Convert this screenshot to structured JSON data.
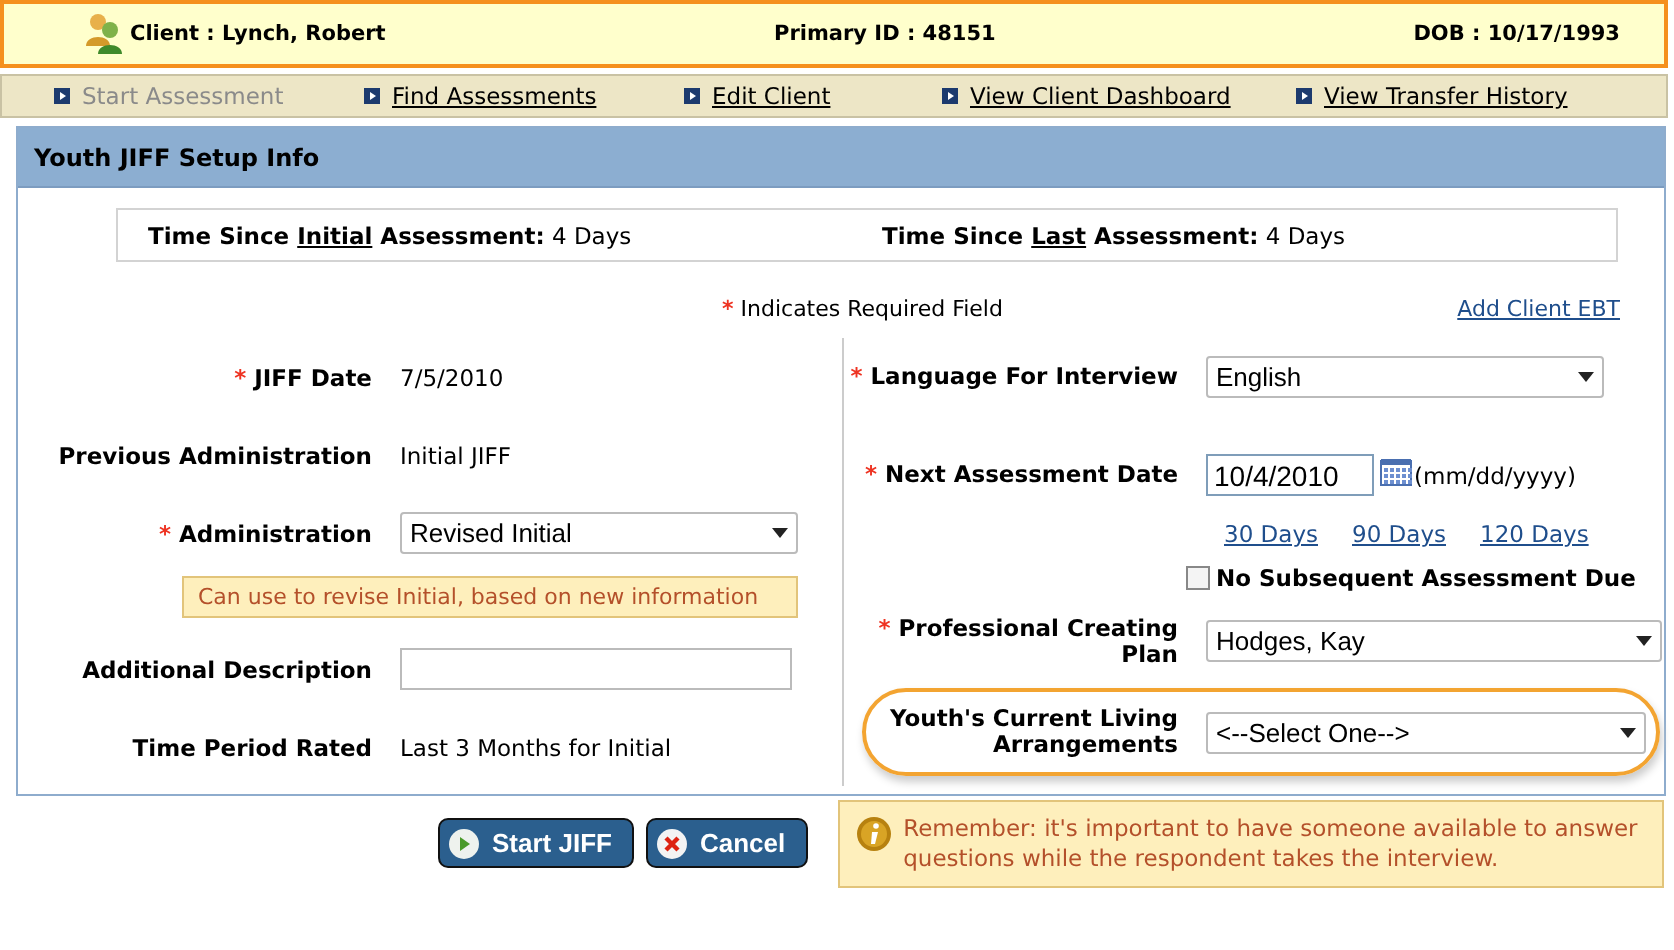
{
  "client_header": {
    "client": "Client : Lynch, Robert",
    "primary_id": "Primary ID : 48151",
    "dob": "DOB : 10/17/1993"
  },
  "nav": [
    {
      "label": "Start Assessment",
      "disabled": true
    },
    {
      "label": "Find Assessments",
      "disabled": false
    },
    {
      "label": "Edit Client",
      "disabled": false
    },
    {
      "label": "View Client Dashboard",
      "disabled": false
    },
    {
      "label": "View Transfer History",
      "disabled": false
    }
  ],
  "panel": {
    "title": "Youth JIFF Setup Info",
    "time_since": [
      {
        "before": "Time Since",
        "underlined": "Initial",
        "after": "Assessment:",
        "value": "4 Days"
      },
      {
        "before": "Time Since",
        "underlined": "Last",
        "after": "Assessment:",
        "value": "4 Days"
      }
    ],
    "required_note": {
      "mark": "*",
      "text": "Indicates Required Field"
    },
    "add_link": "Add Client EBT",
    "left_fields": [
      {
        "kind": "text",
        "mark": "*",
        "label": "JIFF Date",
        "value": "7/5/2010"
      },
      {
        "kind": "text",
        "label": "Previous Administration",
        "value": "Initial JIFF"
      },
      {
        "kind": "select",
        "mark": "*",
        "label": "Administration",
        "value": "Revised Initial"
      },
      {
        "kind": "note",
        "text": "Can use to revise Initial, based on new information"
      },
      {
        "kind": "input",
        "label": "Additional Description"
      },
      {
        "kind": "text",
        "label": "Time Period Rated",
        "value": "Last 3 Months for Initial"
      }
    ],
    "right_fields": [
      {
        "kind": "select",
        "mark": "*",
        "label": "Language For Interview",
        "value": "English",
        "highlighted": false
      },
      {
        "kind": "date",
        "mark": "*",
        "label": "Next Assessment Date",
        "value": "10/4/2010",
        "hint": "(mm/dd/yyyy)",
        "quick_links": [
          "30 Days",
          "90 Days",
          "120 Days"
        ]
      },
      {
        "kind": "checkbox",
        "label": "No Subsequent Assessment Due",
        "checked": false
      },
      {
        "kind": "select",
        "mark": "*",
        "label": "Professional Creating Plan",
        "value": "Hodges, Kay",
        "highlighted": false
      },
      {
        "kind": "select",
        "label": "Youth's Current Living Arrangements",
        "value": "<--Select One-->",
        "highlighted": true
      }
    ]
  },
  "buttons": [
    {
      "kind": "start",
      "label": "Start JIFF"
    },
    {
      "kind": "cancel",
      "label": "Cancel"
    }
  ],
  "reminder": "Remember: it's important to have someone available to answer questions while the respondent takes the interview."
}
